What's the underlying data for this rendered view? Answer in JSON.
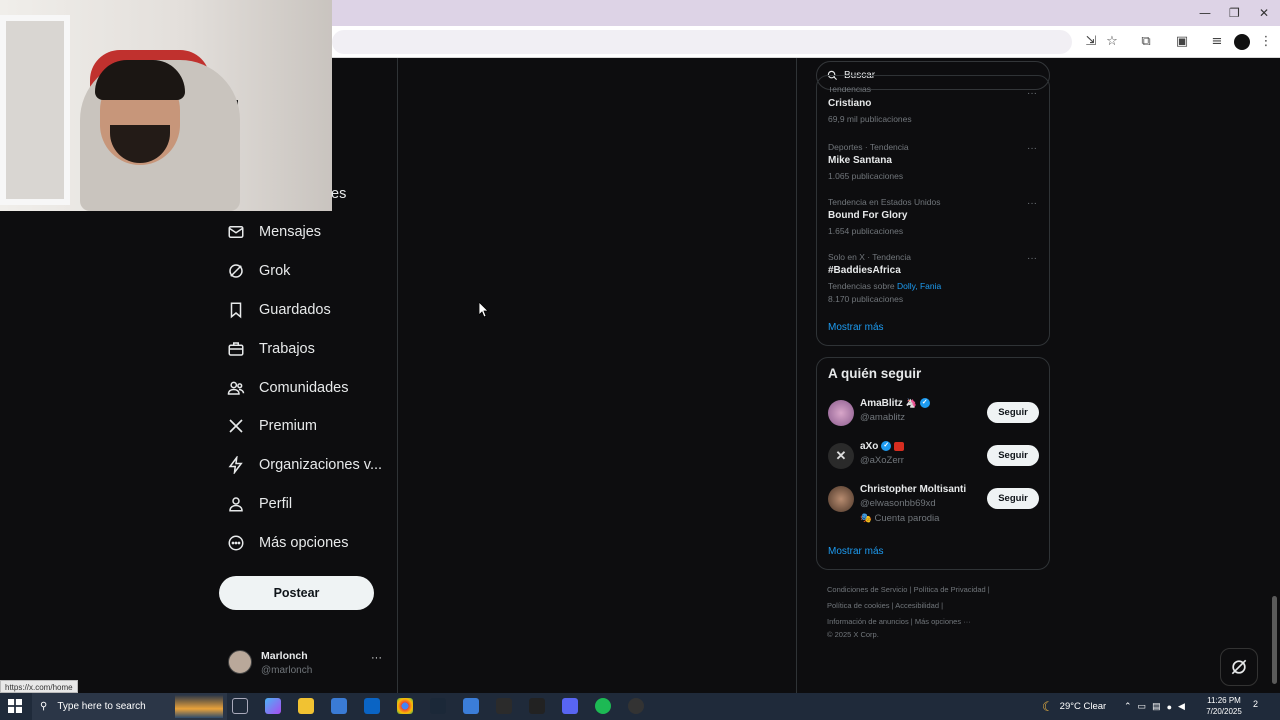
{
  "browser": {
    "window_controls": {
      "minimize": "—",
      "restore": "❐",
      "close": "✕"
    },
    "status_url": "https://x.com/home"
  },
  "sidebar": {
    "partial_label": "es",
    "items": [
      {
        "label": "Mensajes",
        "icon": "mail-icon"
      },
      {
        "label": "Grok",
        "icon": "grok-icon"
      },
      {
        "label": "Guardados",
        "icon": "bookmark-icon"
      },
      {
        "label": "Trabajos",
        "icon": "briefcase-icon"
      },
      {
        "label": "Comunidades",
        "icon": "people-icon"
      },
      {
        "label": "Premium",
        "icon": "x-logo-icon"
      },
      {
        "label": "Organizaciones v...",
        "icon": "lightning-icon"
      },
      {
        "label": "Perfil",
        "icon": "person-icon"
      },
      {
        "label": "Más opciones",
        "icon": "more-circle-icon"
      }
    ],
    "post_button": "Postear",
    "profile": {
      "name": "Marlonch",
      "handle": "@marlonch",
      "more": "···"
    }
  },
  "search": {
    "placeholder": "Buscar"
  },
  "trends": {
    "items": [
      {
        "meta": "Tendencias",
        "name": "Cristiano",
        "count": "69,9 mil publicaciones"
      },
      {
        "meta": "Deportes · Tendencia",
        "name": "Mike Santana",
        "count": "1.065 publicaciones"
      },
      {
        "meta": "Tendencia en Estados Unidos",
        "name": "Bound For Glory",
        "count": "1.654 publicaciones"
      },
      {
        "meta": "Solo en X · Tendencia",
        "name": "#BaddiesAfrica",
        "sub_prefix": "Tendencias sobre ",
        "sub_links": "Dolly, Fania",
        "count": "8.170 publicaciones"
      }
    ],
    "more": "Mostrar más"
  },
  "who_to_follow": {
    "title": "A quién seguir",
    "accounts": [
      {
        "name": "AmaBlitz",
        "handle": "@amablitz",
        "button": "Seguir"
      },
      {
        "name": "aXo",
        "handle": "@aXoZerr",
        "button": "Seguir"
      },
      {
        "name": "Christopher Moltisanti",
        "handle": "@elwasonbb69xd",
        "extra": "Cuenta parodia",
        "button": "Seguir"
      }
    ],
    "more": "Mostrar más"
  },
  "footer": {
    "links_row1": "Condiciones de Servicio  |  Política de Privacidad  |",
    "links_row2": "Política de cookies  |  Accesibilidad  |",
    "links_row3": "Información de anuncios  |  Más opciones ···",
    "copyright": "© 2025 X Corp."
  },
  "taskbar": {
    "search_placeholder": "Type here to search",
    "weather": "29°C  Clear",
    "time": "11:26 PM",
    "date": "7/20/2025",
    "notifications": "2"
  },
  "colors": {
    "accent": "#1d9bf0",
    "background": "#0d0d0f",
    "text": "#e7e9ea",
    "muted": "#71767b"
  }
}
